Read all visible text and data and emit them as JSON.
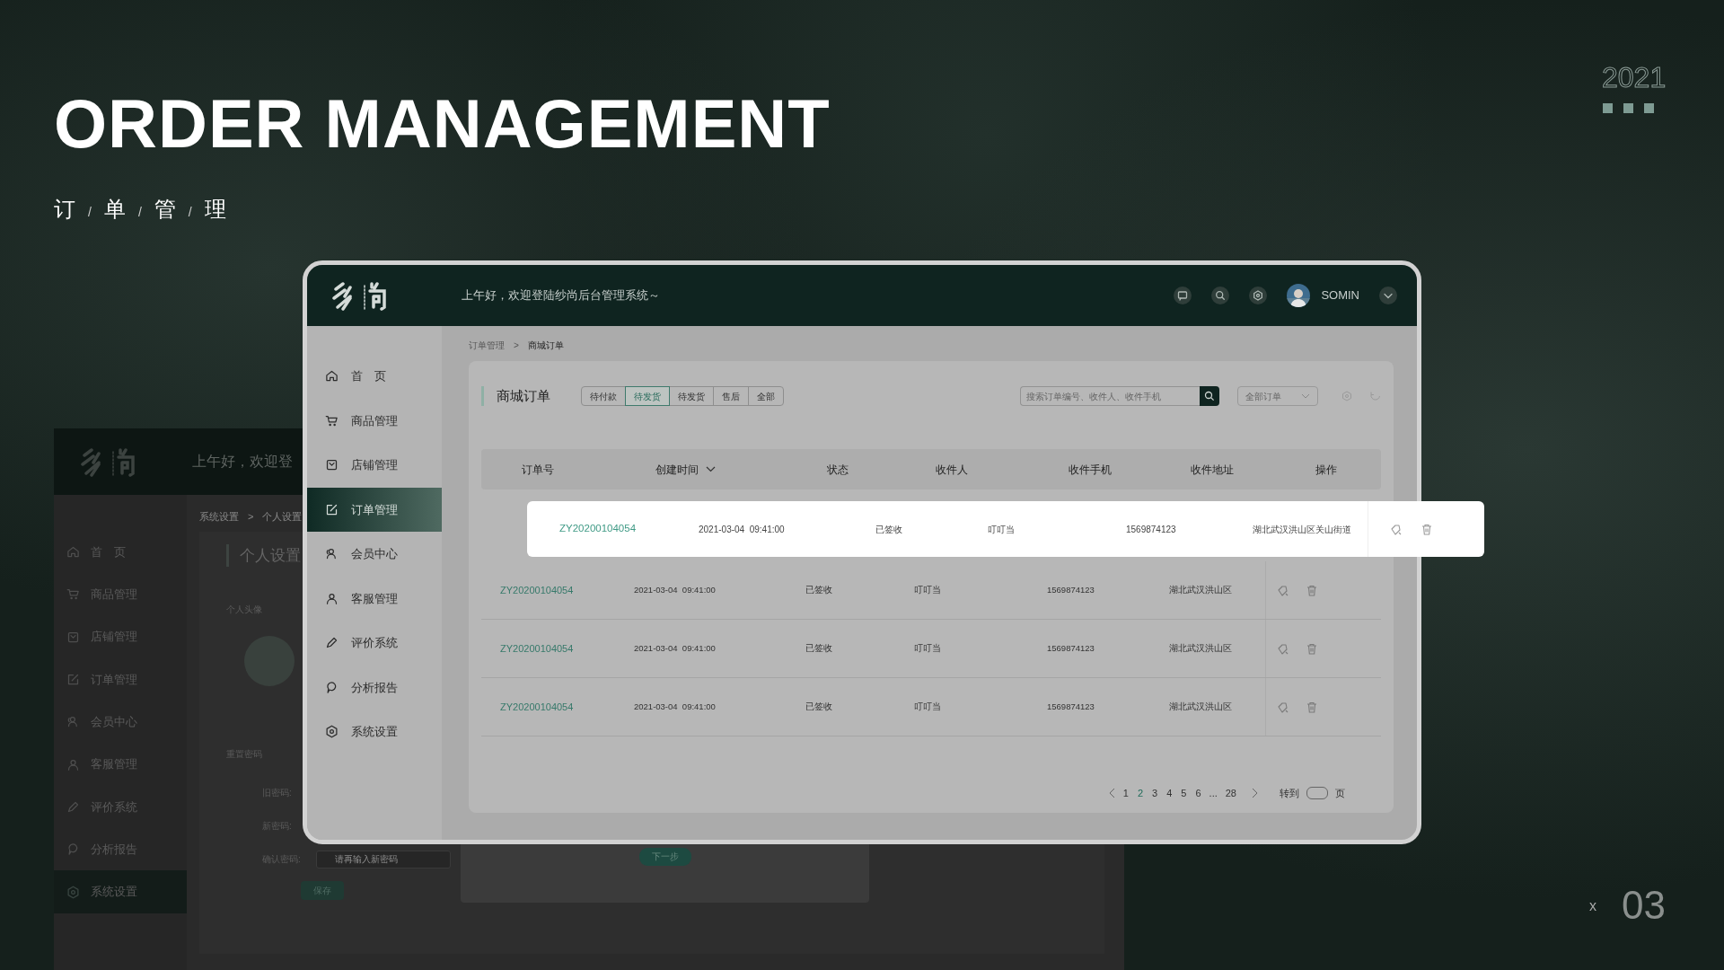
{
  "slide": {
    "title": "ORDER MANAGEMENT",
    "subtitle": [
      "订",
      "/",
      "单",
      "/",
      "管",
      "/",
      "理"
    ],
    "year": "2021",
    "page_prefix": "x",
    "page_number": "03"
  },
  "back_window": {
    "greeting": "上午好，欢迎登",
    "sidebar": [
      {
        "label": "首　页",
        "selected": false
      },
      {
        "label": "商品管理",
        "selected": false
      },
      {
        "label": "店铺管理",
        "selected": false
      },
      {
        "label": "订单管理",
        "selected": false
      },
      {
        "label": "会员中心",
        "selected": false
      },
      {
        "label": "客服管理",
        "selected": false
      },
      {
        "label": "评价系统",
        "selected": false
      },
      {
        "label": "分析报告",
        "selected": false
      },
      {
        "label": "系统设置",
        "selected": true
      }
    ],
    "breadcrumb": [
      "系统设置",
      ">",
      "个人设置"
    ],
    "page_title": "个人设置",
    "avatar_label": "个人头像",
    "section_title": "重置密码",
    "fields": [
      {
        "label": "旧密码:"
      },
      {
        "label": "新密码:"
      },
      {
        "label": "确认密码:",
        "placeholder": "请再输入新密码"
      }
    ],
    "save_button": "保存",
    "next_button": "下一步"
  },
  "main_window": {
    "greeting": "上午好，欢迎登陆纱尚后台管理系统～",
    "user_name": "SOMIN",
    "sidebar": [
      {
        "label": "首　页",
        "selected": false
      },
      {
        "label": "商品管理",
        "selected": false
      },
      {
        "label": "店铺管理",
        "selected": false
      },
      {
        "label": "订单管理",
        "selected": true
      },
      {
        "label": "会员中心",
        "selected": false
      },
      {
        "label": "客服管理",
        "selected": false
      },
      {
        "label": "评价系统",
        "selected": false
      },
      {
        "label": "分析报告",
        "selected": false
      },
      {
        "label": "系统设置",
        "selected": false
      }
    ],
    "breadcrumb": [
      "订单管理",
      ">",
      "商城订单"
    ],
    "page_title": "商城订单",
    "filter_tabs": [
      {
        "label": "待付款",
        "selected": false
      },
      {
        "label": "待发货",
        "selected": true
      },
      {
        "label": "待发货",
        "selected": false
      },
      {
        "label": "售后",
        "selected": false
      },
      {
        "label": "全部",
        "selected": false
      }
    ],
    "search": {
      "placeholder": "搜索订单编号、收件人、收件手机"
    },
    "order_filter": "全部订单",
    "table": {
      "columns": [
        "订单号",
        "创建时间",
        "状态",
        "收件人",
        "收件手机",
        "收件地址",
        "操作"
      ],
      "rows": [
        {
          "order_no": "ZY20200104054",
          "created": "2021-03-04  09:41:00",
          "status": "已签收",
          "recipient": "叮叮当",
          "phone": "1569874123",
          "address": "湖北武汉洪山区"
        },
        {
          "order_no": "ZY20200104054",
          "created": "2021-03-04  09:41:00",
          "status": "已签收",
          "recipient": "叮叮当",
          "phone": "1569874123",
          "address": "湖北武汉洪山区"
        },
        {
          "order_no": "ZY20200104054",
          "created": "2021-03-04  09:41:00",
          "status": "已签收",
          "recipient": "叮叮当",
          "phone": "1569874123",
          "address": "湖北武汉洪山区"
        }
      ]
    },
    "floating_row": {
      "order_no": "ZY20200104054",
      "created": "2021-03-04  09:41:00",
      "status": "已签收",
      "recipient": "叮叮当",
      "phone": "1569874123",
      "address": "湖北武汉洪山区关山街道"
    },
    "pagination": {
      "pages": [
        {
          "kind": "page",
          "label": "1",
          "selected": false
        },
        {
          "kind": "page",
          "label": "2",
          "selected": true
        },
        {
          "kind": "page",
          "label": "3",
          "selected": false
        },
        {
          "kind": "page",
          "label": "4",
          "selected": false
        },
        {
          "kind": "page",
          "label": "5",
          "selected": false
        },
        {
          "kind": "page",
          "label": "6",
          "selected": false
        },
        {
          "kind": "ellipsis",
          "label": "..."
        },
        {
          "kind": "page",
          "label": "28",
          "selected": false
        }
      ],
      "goto_label": "转到",
      "page_unit": "页"
    }
  }
}
